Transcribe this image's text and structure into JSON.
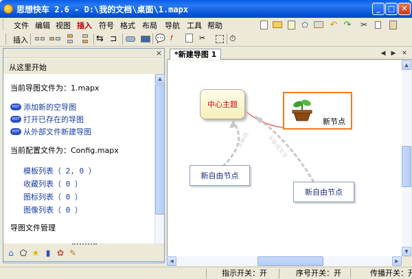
{
  "window": {
    "title": "思想快车 2.6 - D:\\我的文档\\桌面\\1.mapx"
  },
  "menu": [
    "文件",
    "编辑",
    "视图",
    "插入",
    "符号",
    "格式",
    "布局",
    "导航",
    "工具",
    "帮助"
  ],
  "toolbar2": {
    "insert_label": "插入"
  },
  "left_pane": {
    "title": "从这里开始",
    "current_file_label": "当前导图文件为：1.mapx",
    "links": [
      "添加新的空导图",
      "打开已存在的导图",
      "从外部文件新建导图"
    ],
    "hot_badge": "HOT",
    "config_label": "当前配置文件为：Config.mapx",
    "sub_items": [
      "模板列表（ 2, 0 ）",
      "收藏列表（ 0 ）",
      "图标列表（ 0 ）",
      "图像列表（ 0 ）"
    ],
    "section_label": "导图文件管理"
  },
  "tab": {
    "label": "*新建导图 1"
  },
  "canvas": {
    "central_topic": "中心主题",
    "new_node": "新节点",
    "free_node_1": "新自由节点",
    "free_node_2": "新自由节点",
    "connector_1": "关联线",
    "connector_2": "关联线文字"
  },
  "status": {
    "hint_toggle": "指示开关：开",
    "seq_toggle": "序号开关：开",
    "propagate_toggle": "传播开关：开"
  },
  "colors": {
    "title_blue": "#0553d8",
    "central_text": "#d4000f",
    "new_node_border": "#f07d20",
    "link_blue": "#1a3ea0"
  }
}
